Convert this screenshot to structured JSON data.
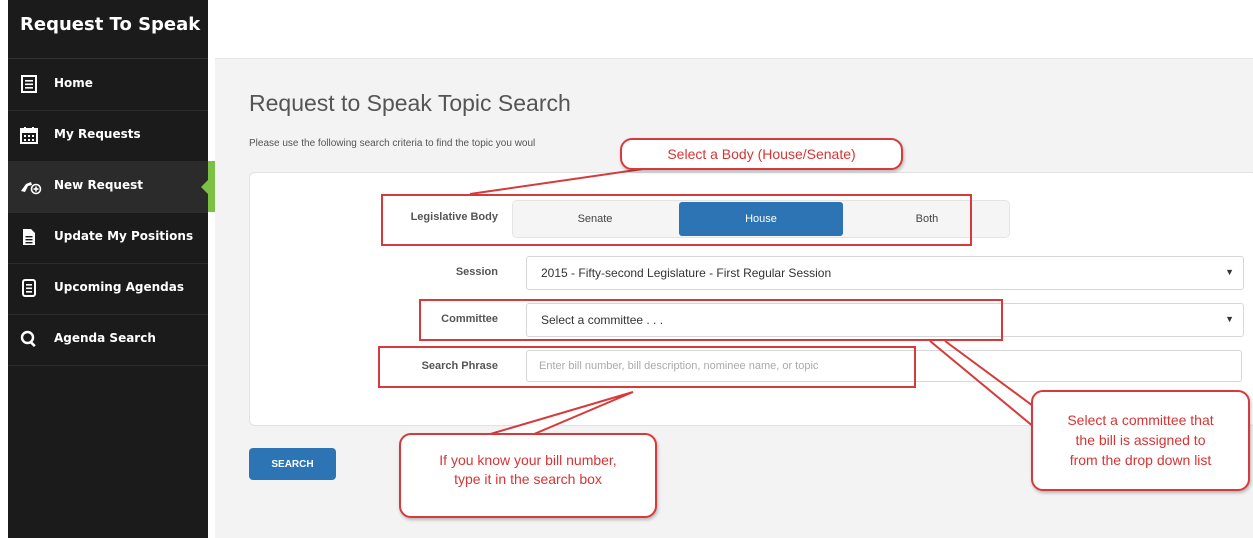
{
  "app": {
    "title": "Request To Speak"
  },
  "sidebar": {
    "items": [
      {
        "label": "Home",
        "icon": "document-icon"
      },
      {
        "label": "My Requests",
        "icon": "calendar-icon"
      },
      {
        "label": "New Request",
        "icon": "hand-plus-icon",
        "active": true
      },
      {
        "label": "Update My Positions",
        "icon": "file-icon"
      },
      {
        "label": "Upcoming Agendas",
        "icon": "list-doc-icon"
      },
      {
        "label": "Agenda Search",
        "icon": "search-icon"
      }
    ],
    "accent_color": "#7cc143"
  },
  "page": {
    "title": "Request to Speak Topic Search",
    "intro": "Please use the following search criteria to find the topic you woul"
  },
  "form": {
    "legislative_body": {
      "label": "Legislative Body",
      "options": [
        "Senate",
        "House",
        "Both"
      ],
      "selected": "House"
    },
    "session": {
      "label": "Session",
      "value": "2015 - Fifty-second Legislature - First Regular Session"
    },
    "committee": {
      "label": "Committee",
      "value": "Select a committee . . ."
    },
    "search_phrase": {
      "label": "Search Phrase",
      "placeholder": "Enter bill number, bill description, nominee name, or topic",
      "value": ""
    },
    "search_button": "SEARCH",
    "primary_color": "#2d74b5"
  },
  "callouts": {
    "body": "Select a Body (House/Senate)",
    "bill_line1": "If you know your bill number,",
    "bill_line2": "type it in the search box",
    "committee_line1": "Select a committee that",
    "committee_line2": "the bill is assigned to",
    "committee_line3": "from the drop down list",
    "color": "#d63a3a"
  }
}
